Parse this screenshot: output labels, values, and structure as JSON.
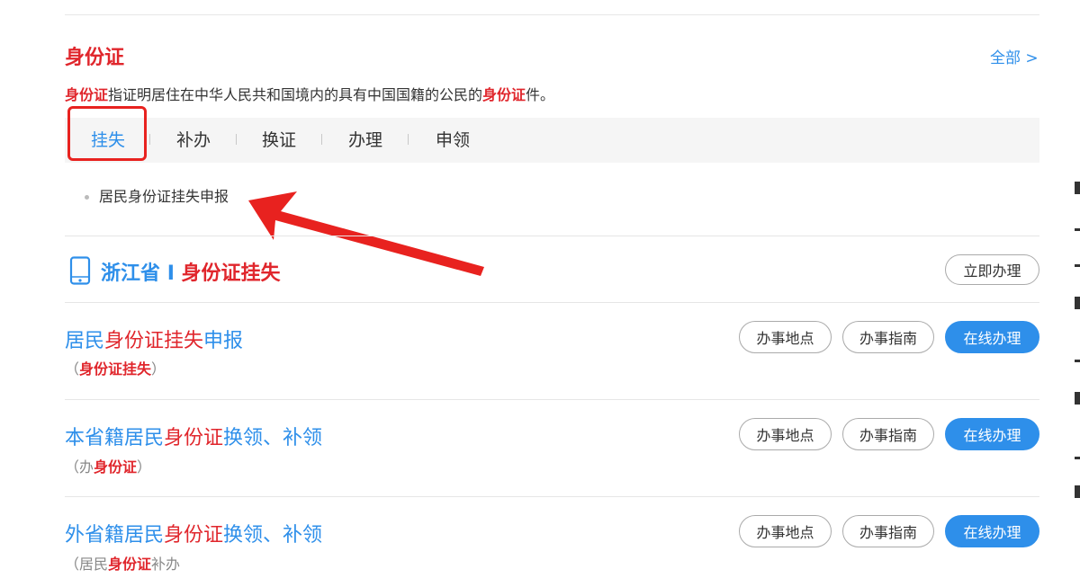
{
  "section": {
    "title": "身份证",
    "all_link": "全部 >",
    "desc_pre": "身份证",
    "desc_mid": "指证明居住在中华人民共和国境内的具有中国国籍的公民的",
    "desc_hl": "身份证",
    "desc_post": "件。"
  },
  "tabs": [
    "挂失",
    "补办",
    "换证",
    "办理",
    "申领"
  ],
  "active_tab": "挂失",
  "tab_results": [
    "居民身份证挂失申报"
  ],
  "region": {
    "province": "浙江省",
    "separator": "I",
    "topic": "身份证挂失",
    "action": "立即办理"
  },
  "services": [
    {
      "title_parts": [
        {
          "text": "居民",
          "hl": false
        },
        {
          "text": "身份证挂失",
          "hl": true
        },
        {
          "text": "申报",
          "hl": false
        }
      ],
      "sub_parts": [
        {
          "text": "（",
          "hl": false
        },
        {
          "text": "身份证挂失",
          "hl": true
        },
        {
          "text": "）",
          "hl": false
        }
      ]
    },
    {
      "title_parts": [
        {
          "text": "本省籍居民",
          "hl": false
        },
        {
          "text": "身份证",
          "hl": true
        },
        {
          "text": "换领、补领",
          "hl": false
        }
      ],
      "sub_parts": [
        {
          "text": "（办",
          "hl": false
        },
        {
          "text": "身份证",
          "hl": true
        },
        {
          "text": "）",
          "hl": false
        }
      ]
    },
    {
      "title_parts": [
        {
          "text": "外省籍居民",
          "hl": false
        },
        {
          "text": "身份证",
          "hl": true
        },
        {
          "text": "换领、补领",
          "hl": false
        }
      ],
      "sub_parts": [
        {
          "text": "（居民",
          "hl": false
        },
        {
          "text": "身份证",
          "hl": true
        },
        {
          "text": "补办",
          "hl": false
        }
      ]
    }
  ],
  "service_buttons": {
    "location": "办事地点",
    "guide": "办事指南",
    "online": "在线办理"
  },
  "colors": {
    "accent_blue": "#2e8fea",
    "highlight_red": "#e0262c",
    "annotation_red": "#e8221f"
  },
  "icons": {
    "phone": "mobile-phone-icon",
    "annotation": "red-arrow-annotation"
  }
}
